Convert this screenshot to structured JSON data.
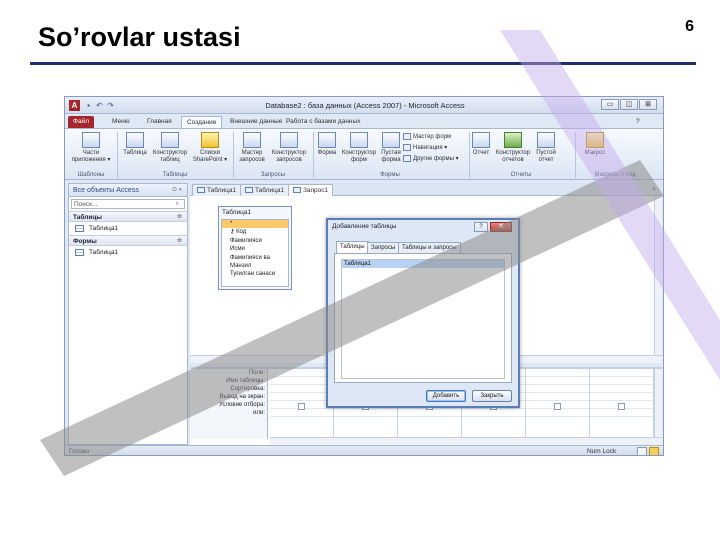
{
  "slide": {
    "title": "So’rovlar ustasi",
    "page_number": "6"
  },
  "window": {
    "title": "Database2 : база данных (Access 2007) - Microsoft Access",
    "app_letter": "A",
    "controls": {
      "minimize": "▭",
      "maximize": "◫",
      "close": "⊠"
    }
  },
  "ribbon": {
    "tabs": [
      "Файл",
      "Меню",
      "Главная",
      "Создание",
      "Внешние данные",
      "Работа с базами данных"
    ],
    "active_tab": "Создание",
    "buttons": {
      "parts": "Части приложения ▾",
      "table": "Таблица",
      "table_designer": "Конструктор таблиц",
      "sharepoint_lists": "Списки SharePoint ▾",
      "query_wizard": "Мастер запросов",
      "query_designer": "Конструктор запросов",
      "form": "Форма",
      "form_designer": "Конструктор форм",
      "blank_form": "Пустая форма",
      "form_wizard": "Мастер форм",
      "navigation": "Навигация ▾",
      "other_forms": "Другие формы ▾",
      "report": "Отчет",
      "report_designer": "Конструктор отчетов",
      "blank_report": "Пустой отчет",
      "macro": "Макрос"
    },
    "groups": [
      "Шаблоны",
      "Таблицы",
      "Запросы",
      "Формы",
      "Отчеты",
      "Макросы и код"
    ]
  },
  "nav_pane": {
    "header": "Все объекты Access",
    "search_placeholder": "Поиск...",
    "sections": [
      {
        "label": "Таблицы",
        "items": [
          "Таблица1"
        ]
      },
      {
        "label": "Формы",
        "items": [
          "Таблица1"
        ]
      }
    ]
  },
  "doc_tabs": [
    "Таблица1",
    "Таблица1",
    "Запрос1"
  ],
  "field_list": {
    "title": "Таблица1",
    "fields": [
      "*",
      "Код",
      "Фамилияси",
      "Исми",
      "Фамилияси ва",
      "Манзил",
      "Туғилган санаси"
    ]
  },
  "design_grid": {
    "row_labels": [
      "Поле:",
      "Имя таблицы:",
      "Сортировка:",
      "Вывод на экран:",
      "Условие отбора:",
      "или:"
    ]
  },
  "status_bar": {
    "left": "Готово",
    "num_lock": "Num Lock"
  },
  "dialog": {
    "title": "Добавление таблицы",
    "help": "?",
    "close": "✕",
    "tabs": [
      "Таблицы",
      "Запросы",
      "Таблицы и запросы"
    ],
    "active_tab": "Таблицы",
    "items": [
      "Таблица1"
    ],
    "add_button": "Добавить",
    "close_button": "Закрыть"
  },
  "colors": {
    "title_rule": "#1f2f6b",
    "file_tab": "#a4262c",
    "watermark_gray": "#8c8c8c",
    "watermark_violet": "#c4a8ee"
  }
}
